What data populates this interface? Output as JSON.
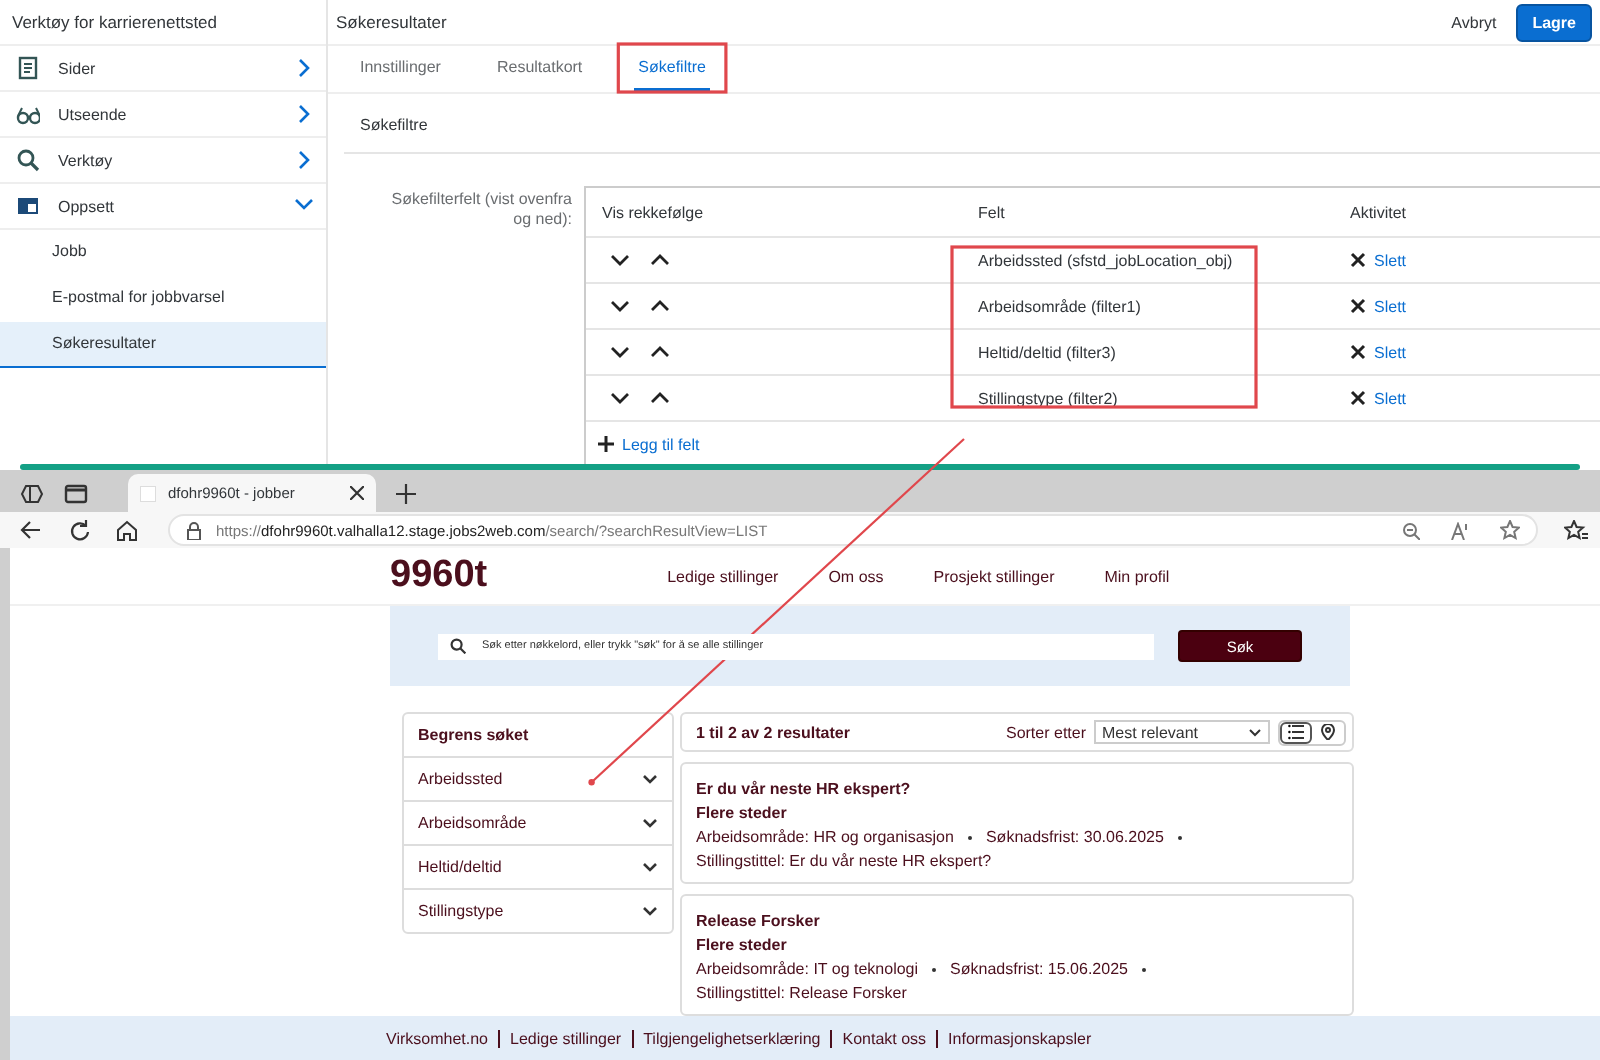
{
  "admin": {
    "sidebar_title": "Verktøy for karrierenettsted",
    "page_title": "Søkeresultater",
    "buttons": [
      {
        "label": "Avbryt",
        "kind": "text"
      },
      {
        "label": "Lagre",
        "kind": "primary"
      }
    ],
    "sidebar": {
      "items": [
        {
          "label": "Sider",
          "expanded": false
        },
        {
          "label": "Utseende",
          "expanded": false
        },
        {
          "label": "Verktøy",
          "expanded": false
        },
        {
          "label": "Oppsett",
          "expanded": true,
          "children": [
            {
              "label": "Jobb",
              "selected": false
            },
            {
              "label": "E-postmal for jobbvarsel",
              "selected": false
            },
            {
              "label": "Søkeresultater",
              "selected": true
            }
          ]
        }
      ]
    },
    "tabs": [
      {
        "label": "Innstillinger",
        "selected": false
      },
      {
        "label": "Resultatkort",
        "selected": false
      },
      {
        "label": "Søkefiltre",
        "selected": true
      }
    ],
    "section_title": "Søkefiltre",
    "field_label": "Søkefilterfelt (vist ovenfra og ned):",
    "table": {
      "columns": [
        "Vis rekkefølge",
        "Felt",
        "Aktivitet"
      ],
      "rows": [
        {
          "field": "Arbeidssted (sfstd_jobLocation_obj)",
          "action": "Slett"
        },
        {
          "field": "Arbeidsområde (filter1)",
          "action": "Slett"
        },
        {
          "field": "Heltid/deltid (filter3)",
          "action": "Slett"
        },
        {
          "field": "Stillingstype (filter2)",
          "action": "Slett"
        }
      ]
    },
    "add_link": "Legg til felt"
  },
  "browser": {
    "tab_title": "dfohr9960t - jobber",
    "url_scheme": "https://",
    "url_host": "dfohr9960t.valhalla12.stage.jobs2web.com",
    "url_path": "/search/?searchResultView=LIST",
    "site": {
      "logo": "9960t",
      "nav": [
        "Ledige stillinger",
        "Om oss",
        "Prosjekt stillinger",
        "Min profil"
      ],
      "search": {
        "placeholder": "Søk etter nøkkelord, eller trykk \"søk\" for å se alle stillinger",
        "button": "Søk"
      },
      "filters": {
        "title": "Begrens søket",
        "items": [
          "Arbeidssted",
          "Arbeidsområde",
          "Heltid/deltid",
          "Stillingstype"
        ]
      },
      "results_count": "1 til 2 av 2 resultater",
      "sort_label": "Sorter etter",
      "sort_value": "Mest relevant",
      "views": [
        {
          "kind": "list",
          "selected": true
        },
        {
          "kind": "map",
          "selected": false
        }
      ],
      "results": [
        {
          "title": "Er du vår neste HR ekspert?",
          "location": "Flere steder",
          "meta": [
            "Arbeidsområde: HR og organisasjon",
            "Søknadsfrist: 30.06.2025",
            "Stillingstittel: Er du vår neste HR ekspert?"
          ]
        },
        {
          "title": "Release Forsker",
          "location": "Flere steder",
          "meta": [
            "Arbeidsområde: IT og teknologi",
            "Søknadsfrist: 15.06.2025",
            "Stillingstittel: Release Forsker"
          ]
        }
      ],
      "footer": [
        "Virksomhet.no",
        "Ledige stillinger",
        "Tilgjengelighetserklæring",
        "Kontakt oss",
        "Informasjonskapsler"
      ]
    }
  }
}
